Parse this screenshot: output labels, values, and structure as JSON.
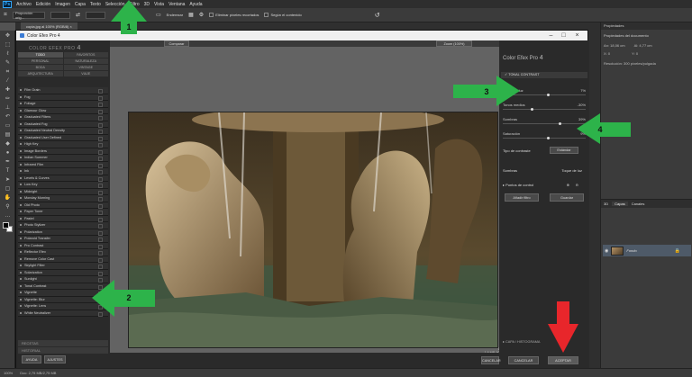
{
  "menu": {
    "items": [
      "Archivo",
      "Edición",
      "Imagen",
      "Capa",
      "Texto",
      "Selección",
      "Filtro",
      "3D",
      "Vista",
      "Ventana",
      "Ayuda"
    ]
  },
  "options": {
    "preset": "Proporción orig...",
    "btn_enderezar": "Enderezar",
    "chk_eliminar": "Eliminar píxeles recortados",
    "chk_segun": "Según el contenido"
  },
  "doc_tab": "copia.jpg al 100% (RGB/8)",
  "properties": {
    "header": "Propiedades",
    "doc_props": "Propiedades del documento",
    "an_label": "An:",
    "an_value": "18,06 cm",
    "al_label": "Al:",
    "al_value": "4,77 cm",
    "x_label": "X:",
    "x_value": "0",
    "y_label": "Y:",
    "y_value": "0",
    "resolution": "Resolución: 300 píxeles/pulgada"
  },
  "layers": {
    "tab_3d": "3D",
    "tab_capas": "Capas",
    "tab_canales": "Canales",
    "layer_name": "Fondo"
  },
  "status": {
    "zoom": "100%",
    "doc": "Doc: 2,75 MB/2,75 MB"
  },
  "cefex": {
    "title": "Color Efex Pro 4",
    "brand": "COLOR EFEX PRO",
    "brand_ver": "4",
    "categories": [
      "TODO",
      "FAVORITOS",
      "PERSONAL",
      "NATURALEZA",
      "BODA",
      "VINTAGE",
      "ARQUITECTURA",
      "VIAJE"
    ],
    "filters": [
      "Film Grain",
      "Fog",
      "Foliage",
      "Glamour Glow",
      "Graduated Filters",
      "Graduated Fog",
      "Graduated Neutral Density",
      "Graduated User Defined",
      "High Key",
      "Image Borders",
      "Indian Summer",
      "Infrared Film",
      "Ink",
      "Levels & Curves",
      "Low Key",
      "Midnight",
      "Monday Morning",
      "Old Photo",
      "Paper Toner",
      "Pastel",
      "Photo Stylizer",
      "Polarization",
      "Polaroid Transfer",
      "Pro Contrast",
      "Reflector Efex",
      "Remove Color Cast",
      "Skylight Filter",
      "Solarization",
      "Sunlight",
      "Tonal Contrast",
      "Vignette",
      "Vignette: Blur",
      "Vignette: Lens",
      "White Neutralizer"
    ],
    "left_bottom": [
      "RECETAS",
      "HISTORIAL"
    ],
    "btn_ayuda": "AYUDA",
    "btn_ajustes": "AJUSTES",
    "btn_compare": "Comparar",
    "zoom_label": "Zoom (100%)",
    "caption1": "DSC_4895 - copia.jpg",
    "caption2": "1,6 MP, 900 PPI, RGB/8 DT Efx",
    "panel_title": "Color Efex Pro",
    "panel_ver": "4",
    "filter_section": "TONAL CONTRAST",
    "sliders": [
      {
        "label": "Toque de luz",
        "value": "7%",
        "pos": 0.55
      },
      {
        "label": "Tonos medios",
        "value": "-30%",
        "pos": 0.35
      },
      {
        "label": "Sombras",
        "value": "39%",
        "pos": 0.69
      },
      {
        "label": "Saturación",
        "value": "9%",
        "pos": 0.55
      }
    ],
    "tipo_label": "Tipo de contraste",
    "tipo_value": "Estándar",
    "sombras": "Sombras",
    "toque": "Toque de luz",
    "puntos": "Puntos de control",
    "add_filter": "Añadir filtro",
    "guardar": "Guardar",
    "histo": "CAPA / HISTOGRAMA",
    "btn_cancelar": "CANCELAR",
    "btn_aceptar": "ACEPTAR",
    "btn_cancel2": "CANCELAR"
  },
  "annotations": [
    {
      "label": "1"
    },
    {
      "label": "2"
    },
    {
      "label": "3"
    },
    {
      "label": "4"
    }
  ],
  "colors": {
    "arrow_green": "#2db34a",
    "arrow_red": "#e8262b"
  }
}
